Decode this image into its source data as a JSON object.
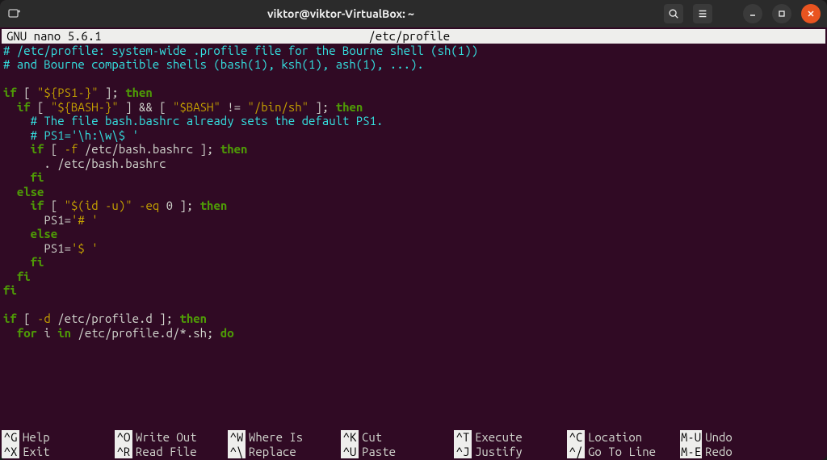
{
  "window": {
    "title": "viktor@viktor-VirtualBox: ~"
  },
  "nano": {
    "app": "GNU nano 5.6.1",
    "file": "/etc/profile"
  },
  "lines": [
    [
      [
        "c-comment",
        "#"
      ],
      [
        "c-comment",
        " /etc/profile: system-wide .profile file for the Bourne shell (sh(1))"
      ]
    ],
    [
      [
        "c-comment",
        "#"
      ],
      [
        "c-comment",
        " and Bourne compatible shells (bash(1), ksh(1), ash(1), ...)."
      ]
    ],
    [
      [
        "",
        ""
      ]
    ],
    [
      [
        "c-key",
        "if"
      ],
      [
        "c-plain",
        " [ "
      ],
      [
        "c-str",
        "\"${PS1-}\""
      ],
      [
        "c-plain",
        " ]; "
      ],
      [
        "c-key",
        "then"
      ]
    ],
    [
      [
        "c-plain",
        "  "
      ],
      [
        "c-key",
        "if"
      ],
      [
        "c-plain",
        " [ "
      ],
      [
        "c-str",
        "\"${BASH-}\""
      ],
      [
        "c-plain",
        " ] && [ "
      ],
      [
        "c-str",
        "\"$BASH\""
      ],
      [
        "c-plain",
        " != "
      ],
      [
        "c-str",
        "\"/bin/sh\""
      ],
      [
        "c-plain",
        " ]; "
      ],
      [
        "c-key",
        "then"
      ]
    ],
    [
      [
        "c-plain",
        "    "
      ],
      [
        "c-comment",
        "# The file bash.bashrc already sets the default PS1."
      ]
    ],
    [
      [
        "c-plain",
        "    "
      ],
      [
        "c-comment",
        "# PS1='\\h:\\w\\$ '"
      ]
    ],
    [
      [
        "c-plain",
        "    "
      ],
      [
        "c-key",
        "if"
      ],
      [
        "c-plain",
        " [ "
      ],
      [
        "c-str",
        "-f"
      ],
      [
        "c-plain",
        " /etc/bash.bashrc ]; "
      ],
      [
        "c-key",
        "then"
      ]
    ],
    [
      [
        "c-plain",
        "      . /etc/bash.bashrc"
      ]
    ],
    [
      [
        "c-plain",
        "    "
      ],
      [
        "c-key",
        "fi"
      ]
    ],
    [
      [
        "c-plain",
        "  "
      ],
      [
        "c-key",
        "else"
      ]
    ],
    [
      [
        "c-plain",
        "    "
      ],
      [
        "c-key",
        "if"
      ],
      [
        "c-plain",
        " [ "
      ],
      [
        "c-str",
        "\"$(id -u)\""
      ],
      [
        "c-plain",
        " "
      ],
      [
        "c-str",
        "-eq"
      ],
      [
        "c-plain",
        " 0 ]; "
      ],
      [
        "c-key",
        "then"
      ]
    ],
    [
      [
        "c-plain",
        "      PS1="
      ],
      [
        "c-str",
        "'# '"
      ]
    ],
    [
      [
        "c-plain",
        "    "
      ],
      [
        "c-key",
        "else"
      ]
    ],
    [
      [
        "c-plain",
        "      PS1="
      ],
      [
        "c-str",
        "'$ '"
      ]
    ],
    [
      [
        "c-plain",
        "    "
      ],
      [
        "c-key",
        "fi"
      ]
    ],
    [
      [
        "c-plain",
        "  "
      ],
      [
        "c-key",
        "fi"
      ]
    ],
    [
      [
        "c-key",
        "fi"
      ]
    ],
    [
      [
        "",
        ""
      ]
    ],
    [
      [
        "c-key",
        "if"
      ],
      [
        "c-plain",
        " [ "
      ],
      [
        "c-str",
        "-d"
      ],
      [
        "c-plain",
        " /etc/profile.d ]; "
      ],
      [
        "c-key",
        "then"
      ]
    ],
    [
      [
        "c-plain",
        "  "
      ],
      [
        "c-key",
        "for"
      ],
      [
        "c-plain",
        " i "
      ],
      [
        "c-key",
        "in"
      ],
      [
        "c-plain",
        " /etc/profile.d/*.sh; "
      ],
      [
        "c-key",
        "do"
      ]
    ]
  ],
  "shortcuts": {
    "row1": [
      {
        "key": "^G",
        "label": "Help"
      },
      {
        "key": "^O",
        "label": "Write Out"
      },
      {
        "key": "^W",
        "label": "Where Is"
      },
      {
        "key": "^K",
        "label": "Cut"
      },
      {
        "key": "^T",
        "label": "Execute"
      },
      {
        "key": "^C",
        "label": "Location"
      },
      {
        "key": "M-U",
        "label": "Undo"
      }
    ],
    "row2": [
      {
        "key": "^X",
        "label": "Exit"
      },
      {
        "key": "^R",
        "label": "Read File"
      },
      {
        "key": "^\\",
        "label": "Replace"
      },
      {
        "key": "^U",
        "label": "Paste"
      },
      {
        "key": "^J",
        "label": "Justify"
      },
      {
        "key": "^/",
        "label": "Go To Line"
      },
      {
        "key": "M-E",
        "label": "Redo"
      }
    ]
  }
}
